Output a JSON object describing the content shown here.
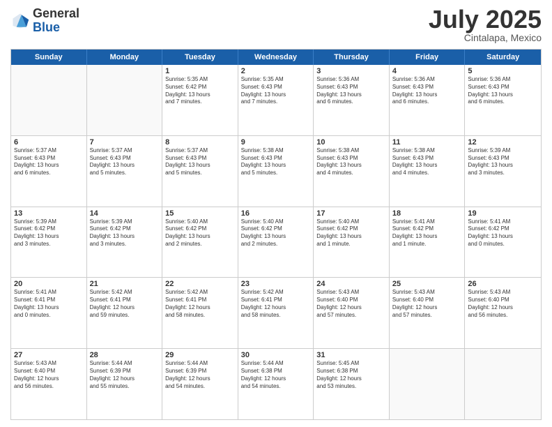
{
  "logo": {
    "general": "General",
    "blue": "Blue"
  },
  "title": {
    "month": "July 2025",
    "location": "Cintalapa, Mexico"
  },
  "header_days": [
    "Sunday",
    "Monday",
    "Tuesday",
    "Wednesday",
    "Thursday",
    "Friday",
    "Saturday"
  ],
  "weeks": [
    [
      {
        "day": "",
        "info": ""
      },
      {
        "day": "",
        "info": ""
      },
      {
        "day": "1",
        "info": "Sunrise: 5:35 AM\nSunset: 6:42 PM\nDaylight: 13 hours\nand 7 minutes."
      },
      {
        "day": "2",
        "info": "Sunrise: 5:35 AM\nSunset: 6:43 PM\nDaylight: 13 hours\nand 7 minutes."
      },
      {
        "day": "3",
        "info": "Sunrise: 5:36 AM\nSunset: 6:43 PM\nDaylight: 13 hours\nand 6 minutes."
      },
      {
        "day": "4",
        "info": "Sunrise: 5:36 AM\nSunset: 6:43 PM\nDaylight: 13 hours\nand 6 minutes."
      },
      {
        "day": "5",
        "info": "Sunrise: 5:36 AM\nSunset: 6:43 PM\nDaylight: 13 hours\nand 6 minutes."
      }
    ],
    [
      {
        "day": "6",
        "info": "Sunrise: 5:37 AM\nSunset: 6:43 PM\nDaylight: 13 hours\nand 6 minutes."
      },
      {
        "day": "7",
        "info": "Sunrise: 5:37 AM\nSunset: 6:43 PM\nDaylight: 13 hours\nand 5 minutes."
      },
      {
        "day": "8",
        "info": "Sunrise: 5:37 AM\nSunset: 6:43 PM\nDaylight: 13 hours\nand 5 minutes."
      },
      {
        "day": "9",
        "info": "Sunrise: 5:38 AM\nSunset: 6:43 PM\nDaylight: 13 hours\nand 5 minutes."
      },
      {
        "day": "10",
        "info": "Sunrise: 5:38 AM\nSunset: 6:43 PM\nDaylight: 13 hours\nand 4 minutes."
      },
      {
        "day": "11",
        "info": "Sunrise: 5:38 AM\nSunset: 6:43 PM\nDaylight: 13 hours\nand 4 minutes."
      },
      {
        "day": "12",
        "info": "Sunrise: 5:39 AM\nSunset: 6:43 PM\nDaylight: 13 hours\nand 3 minutes."
      }
    ],
    [
      {
        "day": "13",
        "info": "Sunrise: 5:39 AM\nSunset: 6:42 PM\nDaylight: 13 hours\nand 3 minutes."
      },
      {
        "day": "14",
        "info": "Sunrise: 5:39 AM\nSunset: 6:42 PM\nDaylight: 13 hours\nand 3 minutes."
      },
      {
        "day": "15",
        "info": "Sunrise: 5:40 AM\nSunset: 6:42 PM\nDaylight: 13 hours\nand 2 minutes."
      },
      {
        "day": "16",
        "info": "Sunrise: 5:40 AM\nSunset: 6:42 PM\nDaylight: 13 hours\nand 2 minutes."
      },
      {
        "day": "17",
        "info": "Sunrise: 5:40 AM\nSunset: 6:42 PM\nDaylight: 13 hours\nand 1 minute."
      },
      {
        "day": "18",
        "info": "Sunrise: 5:41 AM\nSunset: 6:42 PM\nDaylight: 13 hours\nand 1 minute."
      },
      {
        "day": "19",
        "info": "Sunrise: 5:41 AM\nSunset: 6:42 PM\nDaylight: 13 hours\nand 0 minutes."
      }
    ],
    [
      {
        "day": "20",
        "info": "Sunrise: 5:41 AM\nSunset: 6:41 PM\nDaylight: 13 hours\nand 0 minutes."
      },
      {
        "day": "21",
        "info": "Sunrise: 5:42 AM\nSunset: 6:41 PM\nDaylight: 12 hours\nand 59 minutes."
      },
      {
        "day": "22",
        "info": "Sunrise: 5:42 AM\nSunset: 6:41 PM\nDaylight: 12 hours\nand 58 minutes."
      },
      {
        "day": "23",
        "info": "Sunrise: 5:42 AM\nSunset: 6:41 PM\nDaylight: 12 hours\nand 58 minutes."
      },
      {
        "day": "24",
        "info": "Sunrise: 5:43 AM\nSunset: 6:40 PM\nDaylight: 12 hours\nand 57 minutes."
      },
      {
        "day": "25",
        "info": "Sunrise: 5:43 AM\nSunset: 6:40 PM\nDaylight: 12 hours\nand 57 minutes."
      },
      {
        "day": "26",
        "info": "Sunrise: 5:43 AM\nSunset: 6:40 PM\nDaylight: 12 hours\nand 56 minutes."
      }
    ],
    [
      {
        "day": "27",
        "info": "Sunrise: 5:43 AM\nSunset: 6:40 PM\nDaylight: 12 hours\nand 56 minutes."
      },
      {
        "day": "28",
        "info": "Sunrise: 5:44 AM\nSunset: 6:39 PM\nDaylight: 12 hours\nand 55 minutes."
      },
      {
        "day": "29",
        "info": "Sunrise: 5:44 AM\nSunset: 6:39 PM\nDaylight: 12 hours\nand 54 minutes."
      },
      {
        "day": "30",
        "info": "Sunrise: 5:44 AM\nSunset: 6:38 PM\nDaylight: 12 hours\nand 54 minutes."
      },
      {
        "day": "31",
        "info": "Sunrise: 5:45 AM\nSunset: 6:38 PM\nDaylight: 12 hours\nand 53 minutes."
      },
      {
        "day": "",
        "info": ""
      },
      {
        "day": "",
        "info": ""
      }
    ]
  ]
}
